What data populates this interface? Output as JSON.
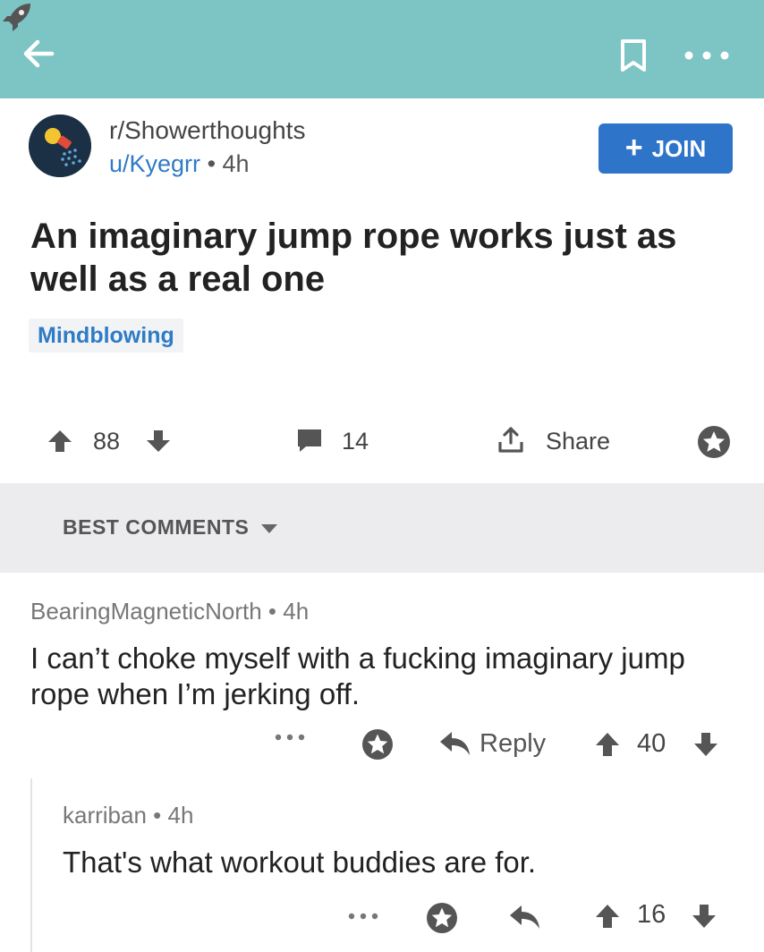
{
  "topbar": {
    "background": "#7cc5c4",
    "icons": [
      "back-arrow-icon",
      "bookmark-icon",
      "more-icon"
    ]
  },
  "post": {
    "subreddit": "r/Showerthoughts",
    "author": "u/Kyegrr",
    "age": "• 4h",
    "join_label": "JOIN",
    "title": "An imaginary jump rope works just as well as a real one",
    "flair": "Mindblowing",
    "upvotes": "88",
    "comments": "14",
    "share_label": "Share",
    "accent": "#2e74c9"
  },
  "sort": {
    "label": "BEST COMMENTS"
  },
  "comments": [
    {
      "author": "BearingMagneticNorth • 4h",
      "body": "I can’t choke myself with a fucking imaginary jump rope when I’m jerking off.",
      "reply_label": "Reply",
      "votes": "40"
    },
    {
      "author": "karriban • 4h",
      "body": "That's what workout buddies are for.",
      "votes": "16"
    }
  ]
}
